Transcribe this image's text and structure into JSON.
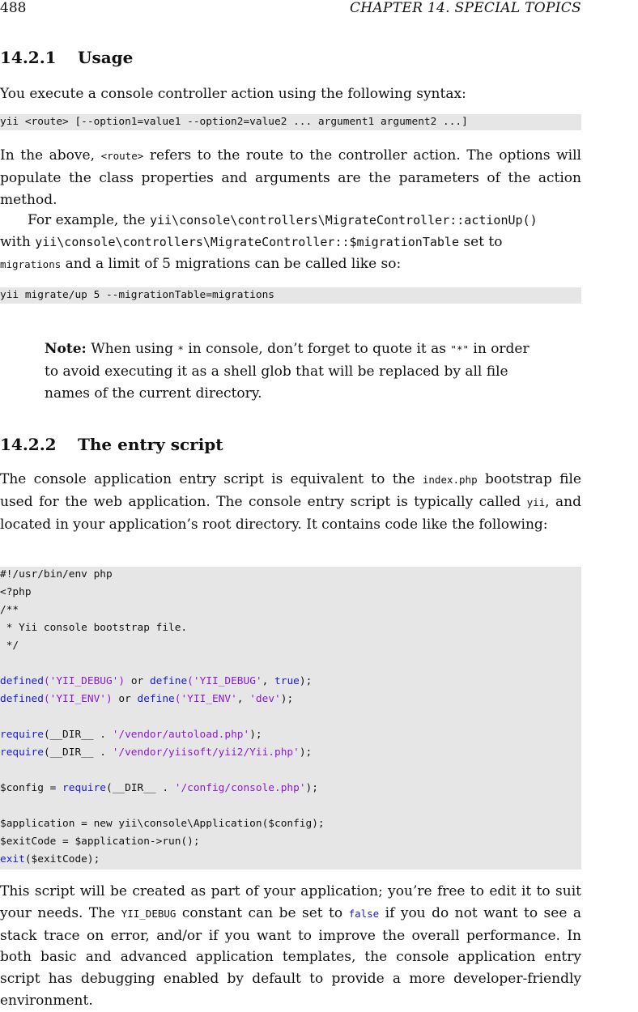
{
  "header": {
    "page_number": "488",
    "chapter": "CHAPTER 14.  SPECIAL TOPICS"
  },
  "section_usage": {
    "number": "14.2.1",
    "title": "Usage",
    "intro": "You execute a console controller action using the following syntax:",
    "syntax": "yii <route> [--option1=value1 --option2=value2 ... argument1 argument2 ...]",
    "p1_a": "In the above, ",
    "p1_code": "<route>",
    "p1_b": " refers to the route to the controller action. The options will populate the class properties and arguments are the parameters of the action method.",
    "p2_a": "For example, the ",
    "p2_code1": "yii\\console\\controllers\\MigrateController::actionUp()",
    "p2_b": " with ",
    "p2_code2": "yii\\console\\controllers\\MigrateController::$migrationTable",
    "p2_c": " set to ",
    "p2_code3": "migrations",
    "p2_d": " and a limit of 5 migrations can be called like so:",
    "example": "yii migrate/up 5 --migrationTable=migrations"
  },
  "note": {
    "label": "Note:",
    "a": " When using ",
    "code1": "*",
    "b": " in console, don’t forget to quote it as ",
    "code2": "\"*\"",
    "c": " in order to avoid executing it as a shell glob that will be replaced by all file names of the current directory."
  },
  "section_entry": {
    "number": "14.2.2",
    "title": "The entry script",
    "p1_a": "The console application entry script is equivalent to the ",
    "p1_code1": "index.php",
    "p1_b": " bootstrap file used for the web application. The console entry script is typically called ",
    "p1_code2": "yii",
    "p1_c": ", and located in your application’s root directory. It contains code like the following:",
    "code": {
      "l1": "#!/usr/bin/env php",
      "l2": "<?php",
      "l3": "/**",
      "l4": " * Yii console bootstrap file.",
      "l5": " */",
      "l7_fn1": "defined",
      "l7_s1": "('YII_DEBUG')",
      "l7_op": " or ",
      "l7_fn2": "define",
      "l7_s2": "('YII_DEBUG'",
      "l7_comma": ", ",
      "l7_kw": "true",
      "l7_end": ");",
      "l8_fn1": "defined",
      "l8_s1": "('YII_ENV')",
      "l8_op": " or ",
      "l8_fn2": "define",
      "l8_s2": "('YII_ENV'",
      "l8_comma": ", ",
      "l8_s3": "'dev'",
      "l8_end": ");",
      "l10_fn": "require",
      "l10_a": "(__DIR__ . ",
      "l10_s": "'/vendor/autoload.php'",
      "l10_end": ");",
      "l11_fn": "require",
      "l11_a": "(__DIR__ . ",
      "l11_s": "'/vendor/yiisoft/yii2/Yii.php'",
      "l11_end": ");",
      "l13_a": "$config = ",
      "l13_fn": "require",
      "l13_b": "(__DIR__ . ",
      "l13_s": "'/config/console.php'",
      "l13_end": ");",
      "l15": "$application = new yii\\console\\Application($config);",
      "l16": "$exitCode = $application->run();",
      "l17_fn": "exit",
      "l17_end": "($exitCode);"
    },
    "p2_a": "This script will be created as part of your application; you’re free to edit it to suit your needs. The ",
    "p2_code1": "YII_DEBUG",
    "p2_b": " constant can be set to ",
    "p2_code2": "false",
    "p2_c": " if you do not want to see a stack trace on error, and/or if you want to improve the overall performance. In both basic and advanced application templates, the console application entry script has debugging enabled by default to provide a more developer-friendly environment."
  }
}
